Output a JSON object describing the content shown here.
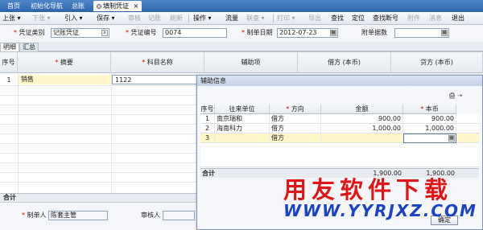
{
  "tabs": [
    {
      "label": "首页"
    },
    {
      "label": "初始化导航"
    },
    {
      "label": "总账"
    },
    {
      "label": "填制凭证",
      "active": true
    }
  ],
  "toolbar": {
    "items": [
      {
        "label": "上张",
        "enabled": true
      },
      {
        "label": "下张",
        "enabled": false
      },
      {
        "label": "引入",
        "enabled": true
      },
      {
        "label": "保存",
        "enabled": true
      },
      {
        "label": "审核",
        "enabled": false
      },
      {
        "label": "记账",
        "enabled": false
      },
      {
        "label": "刷新",
        "enabled": false
      },
      {
        "label": "操作",
        "enabled": true
      },
      {
        "label": "流量",
        "enabled": true
      },
      {
        "label": "联查",
        "enabled": false
      },
      {
        "label": "打印",
        "enabled": false
      },
      {
        "label": "导出",
        "enabled": false
      },
      {
        "label": "查找",
        "enabled": true
      },
      {
        "label": "定位",
        "enabled": true
      },
      {
        "label": "查找断号",
        "enabled": true
      },
      {
        "label": "附件",
        "enabled": false
      },
      {
        "label": "消息",
        "enabled": false
      },
      {
        "label": "退出",
        "enabled": true
      }
    ]
  },
  "form": {
    "voucher_type_label": "凭证类别",
    "voucher_type_value": "记账凭证",
    "voucher_no_label": "凭证编号",
    "voucher_no_value": "0074",
    "date_label": "制单日期",
    "date_value": "2012-07-23",
    "attach_label": "附单据数",
    "attach_value": ""
  },
  "subtabs": [
    {
      "label": "明细",
      "active": true
    },
    {
      "label": "汇总",
      "active": false
    }
  ],
  "grid": {
    "headers": {
      "no": "序号",
      "summary": "摘要",
      "account": "科目名称",
      "aux": "辅助项",
      "debit": "借方 (本币)",
      "credit": "贷方 (本币)"
    },
    "rows": [
      {
        "no": "1",
        "summary": "销售",
        "account": "1122"
      }
    ],
    "total_label": "合计"
  },
  "footer": {
    "maker_label": "制单人",
    "maker_value": "陈套主管",
    "auditor_label": "审核人"
  },
  "popup": {
    "title": "辅助信息",
    "headers": {
      "no": "序号",
      "unit": "往来单位",
      "direction": "方向",
      "amount": "金额",
      "local": "本币"
    },
    "rows": [
      {
        "no": "1",
        "unit": "南京瑞和",
        "direction": "借方",
        "amount": "900.00",
        "local": "900.00"
      },
      {
        "no": "2",
        "unit": "海南科力",
        "direction": "借方",
        "amount": "1,000.00",
        "local": "1,000.00"
      },
      {
        "no": "3",
        "unit": "",
        "direction": "借方",
        "amount": "",
        "local": ""
      }
    ],
    "total_label": "合计",
    "total_amount": "1,900.00",
    "total_local": "1,900.00",
    "ok_label": "确定"
  },
  "watermark": {
    "chinese": "用友软件下载",
    "url": "WWW.YYRJXZ.COM"
  },
  "colors": {
    "accent": "#2f64a8",
    "highlight_row": "#fff7c8",
    "watermark_red": "#e01616",
    "watermark_blue": "#1a43c8"
  }
}
